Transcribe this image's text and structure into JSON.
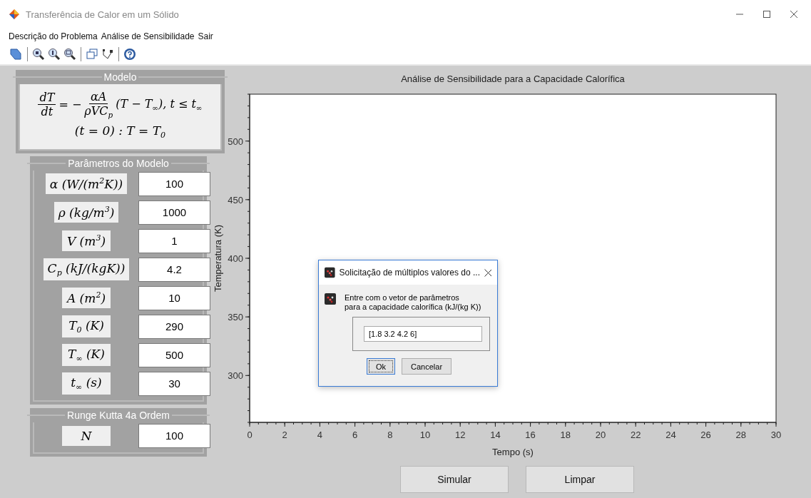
{
  "window": {
    "title": "Transferência de Calor em um Sólido"
  },
  "menu": [
    "Descrição do Problema",
    "Análise de Sensibilidade",
    "Sair"
  ],
  "model": {
    "title": "Modelo",
    "equation": {
      "lhs_numerator": "dT",
      "lhs_denominator": "dt",
      "operator": "= −",
      "rhs_numerator": "αA",
      "rhs_denominator": "ρVC$_{p}$",
      "rest": "(T − T$_{∞}$), t ≤ t$_{∞}$"
    },
    "initial_condition": "(t = 0) : T = T$_{0}$"
  },
  "parameters": {
    "title": "Parâmetros do Modelo",
    "rows": [
      {
        "label": "α (W/(m$^{2}$K))",
        "value": "100"
      },
      {
        "label": "ρ (kg/m$^{3}$)",
        "value": "1000"
      },
      {
        "label": "V (m$^{3}$)",
        "value": "1"
      },
      {
        "label": "C$_{p}$ (kJ/(kgK))",
        "value": "4.2"
      },
      {
        "label": "A (m$^{2}$)",
        "value": "10"
      },
      {
        "label": "T$_{0}$ (K)",
        "value": "290"
      },
      {
        "label": "T$_{∞}$ (K)",
        "value": "500"
      },
      {
        "label": "t$_{∞}$ (s)",
        "value": "30"
      }
    ]
  },
  "solver": {
    "title": "Runge Kutta 4a Ordem",
    "rows": [
      {
        "label": "N",
        "value": "100"
      }
    ]
  },
  "chart": {
    "chart_data": {
      "type": "line",
      "title": "Análise de Sensibilidade para a Capacidade Calorífica",
      "xlabel": "Tempo (s)",
      "ylabel": "Temperatura (K)",
      "xlim": [
        0,
        30
      ],
      "ylim": [
        260,
        540
      ],
      "xticks": [
        0,
        2,
        4,
        6,
        8,
        10,
        12,
        14,
        16,
        18,
        20,
        22,
        24,
        26,
        28,
        30
      ],
      "yticks": [
        300,
        350,
        400,
        450,
        500
      ]
    }
  },
  "buttons": [
    "Simular",
    "Limpar"
  ],
  "dialog": {
    "title": "Solicitação de múltiplos valores do ...",
    "message": [
      "Entre com o vetor de parâmetros",
      "para a capacidade calorífica (kJ/(kg K))"
    ],
    "value": "[1.8 3.2 4.2 6]",
    "buttons": [
      {
        "label": "Ok",
        "focused": true
      },
      {
        "label": "Cancelar",
        "focused": false
      }
    ]
  }
}
